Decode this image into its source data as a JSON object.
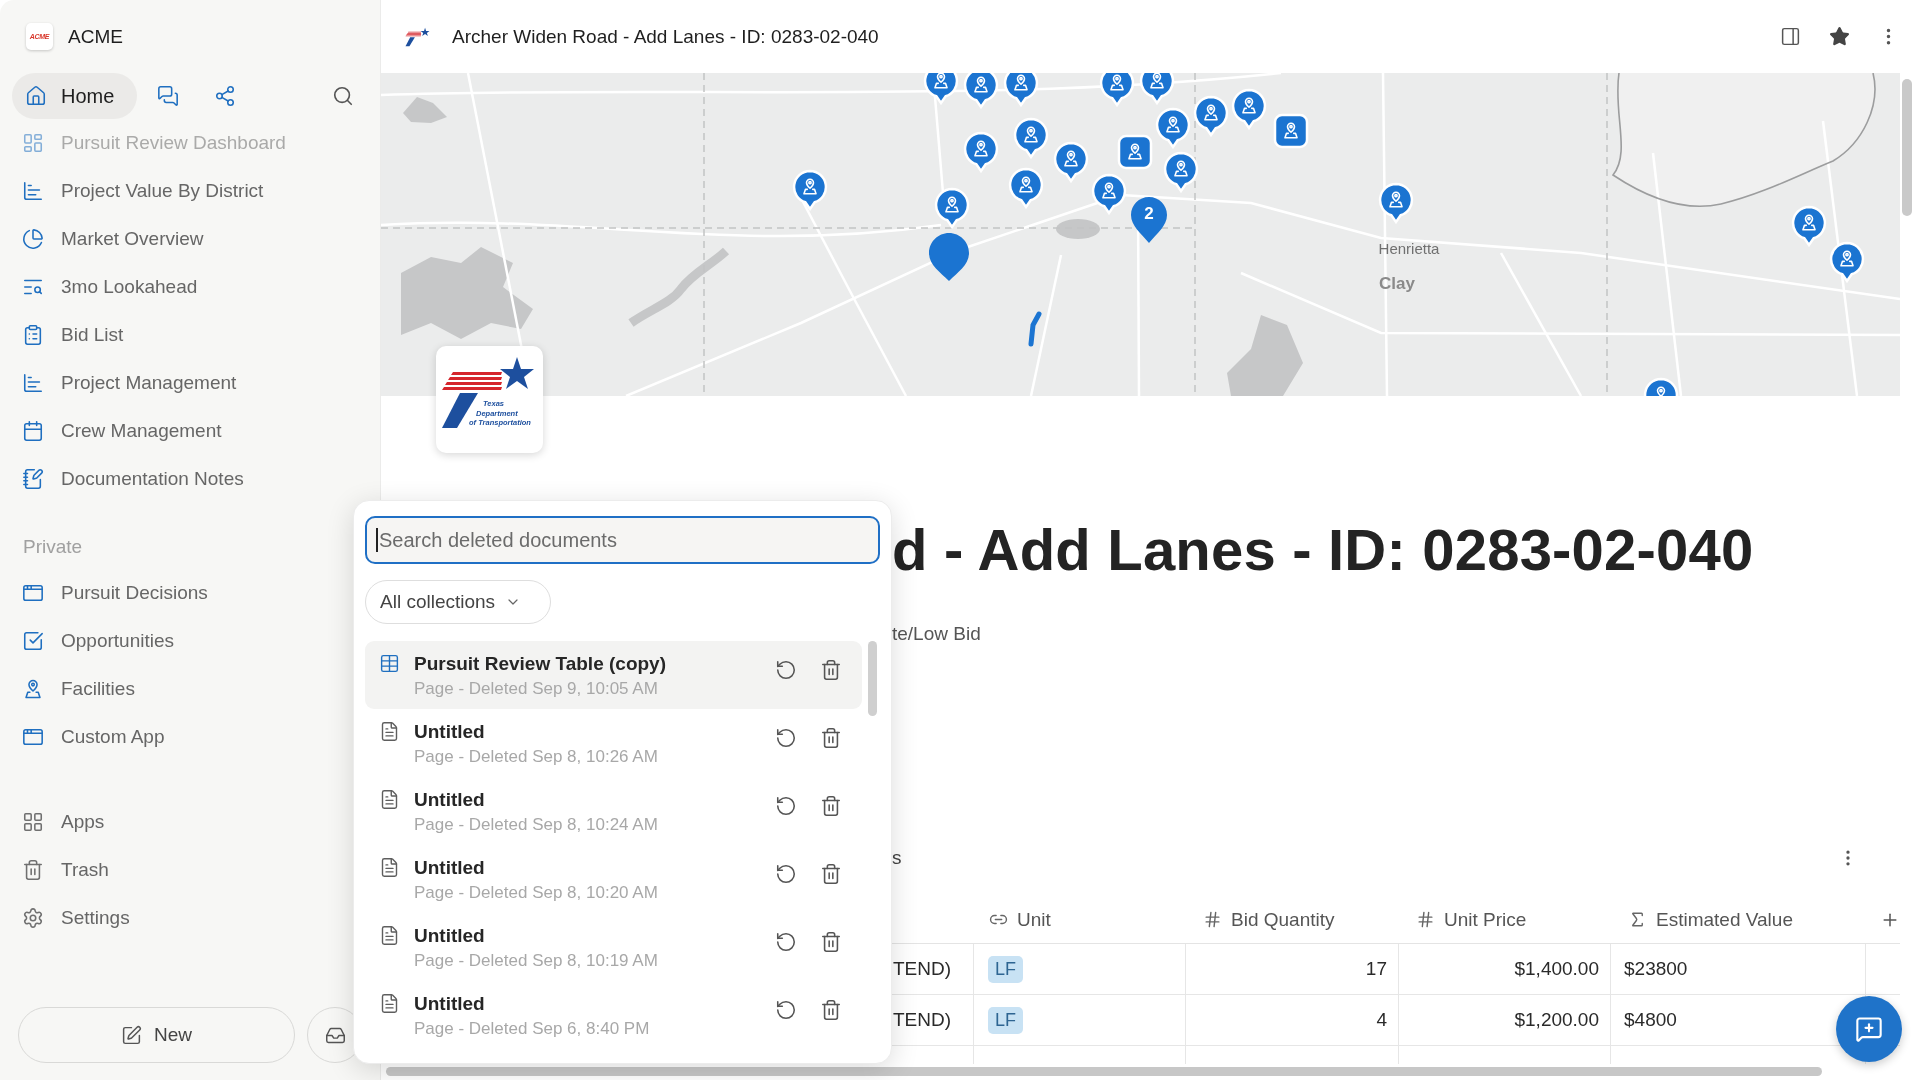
{
  "sidebar": {
    "workspace": {
      "logo_text": "ACME",
      "name": "ACME"
    },
    "nav": [
      {
        "label": "Home",
        "selected": true
      },
      {
        "selected": false
      },
      {
        "selected": false
      }
    ],
    "items": [
      {
        "label": "Pursuit Review Dashboard"
      },
      {
        "label": "Project Value By District"
      },
      {
        "label": "Market Overview"
      },
      {
        "label": "3mo Lookahead"
      },
      {
        "label": "Bid List"
      },
      {
        "label": "Project Management"
      },
      {
        "label": "Crew Management"
      },
      {
        "label": "Documentation Notes"
      }
    ],
    "private": {
      "title": "Private",
      "items": [
        {
          "label": "Pursuit Decisions"
        },
        {
          "label": "Opportunities"
        },
        {
          "label": "Facilities"
        },
        {
          "label": "Custom App"
        }
      ]
    },
    "bottom_items": [
      {
        "label": "Apps"
      },
      {
        "label": "Trash"
      },
      {
        "label": "Settings"
      }
    ],
    "new_button": "New"
  },
  "header": {
    "title": "Archer Widen Road - Add Lanes - ID: 0283-02-040",
    "starred": true
  },
  "map": {
    "labels": [
      {
        "text": "Henrietta",
        "kind": "town"
      },
      {
        "text": "Clay",
        "kind": "county"
      }
    ],
    "cluster_count": "2"
  },
  "logo_card": {
    "lines": [
      "Texas",
      "Department",
      "of Transportation"
    ]
  },
  "page": {
    "title": "d - Add Lanes - ID: 0283-02-040",
    "subtitle": "te/Low Bid",
    "section_title": "s"
  },
  "table": {
    "columns": [
      {
        "label": "Unit",
        "kind": "relation"
      },
      {
        "label": "Bid Quantity",
        "kind": "number"
      },
      {
        "label": "Unit Price",
        "kind": "number"
      },
      {
        "label": "Estimated Value",
        "kind": "formula"
      }
    ],
    "rows": [
      {
        "column_1": "TEND)",
        "cells": [
          {
            "text": "LF",
            "color": "#c8e2f4"
          },
          {
            "text": "17"
          },
          {
            "text": "$1,400.00"
          },
          {
            "text": "$23800"
          }
        ]
      },
      {
        "column_1": "TEND)",
        "cells": [
          {
            "text": "LF",
            "color": "#c8e2f4"
          },
          {
            "text": "4"
          },
          {
            "text": "$1,200.00"
          },
          {
            "text": "$4800"
          }
        ]
      }
    ]
  },
  "trash_popup": {
    "search": {
      "placeholder": "Search deleted documents",
      "focused": true
    },
    "filter": "All collections",
    "items": [
      {
        "kind": "table",
        "title": "Pursuit Review Table (copy)",
        "subtitle": "Page - Deleted Sep 9, 10:05 AM",
        "selected": true
      },
      {
        "kind": "page",
        "title": "Untitled",
        "subtitle": "Page - Deleted Sep 8, 10:26 AM",
        "selected": false
      },
      {
        "kind": "page",
        "title": "Untitled",
        "subtitle": "Page - Deleted Sep 8, 10:24 AM",
        "selected": false
      },
      {
        "kind": "page",
        "title": "Untitled",
        "subtitle": "Page - Deleted Sep 8, 10:20 AM",
        "selected": false
      },
      {
        "kind": "page",
        "title": "Untitled",
        "subtitle": "Page - Deleted Sep 8, 10:19 AM",
        "selected": false
      },
      {
        "kind": "page",
        "title": "Untitled",
        "subtitle": "Page - Deleted Sep 6, 8:40 PM",
        "selected": false
      }
    ]
  }
}
